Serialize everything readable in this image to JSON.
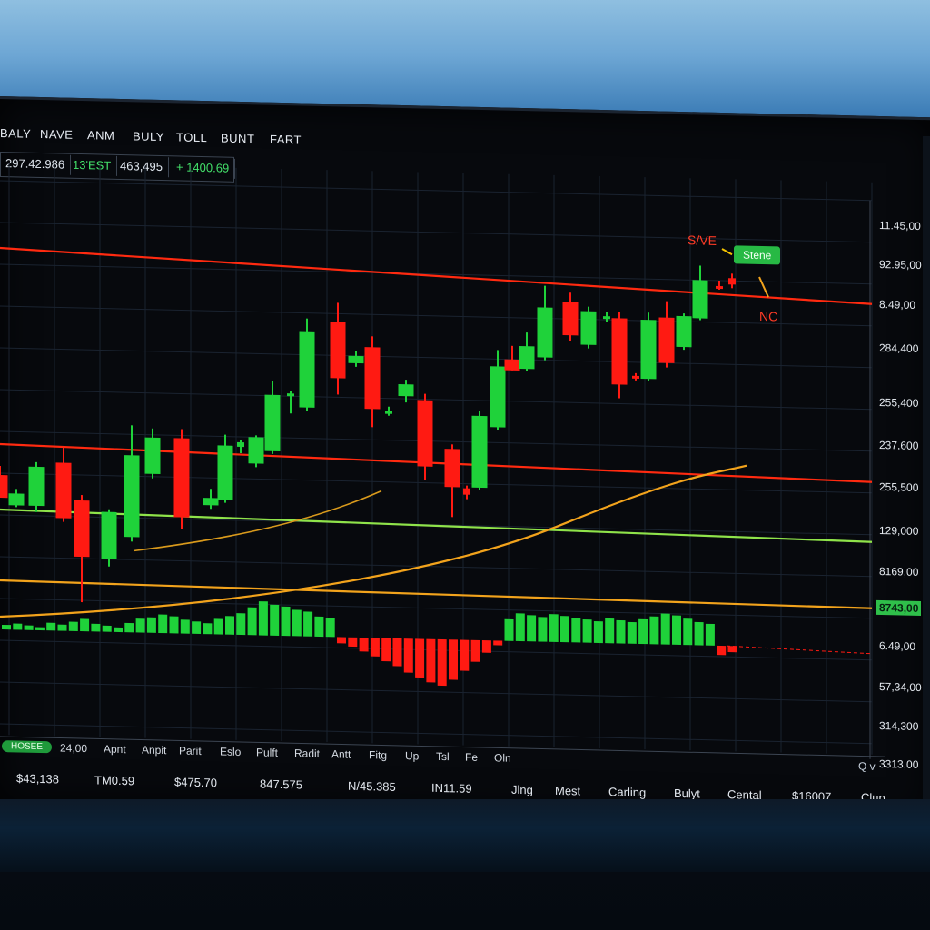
{
  "menu": [
    "BALY",
    "NAVE",
    "ANM",
    "BULY",
    "TOLL",
    "BUNT",
    "FART"
  ],
  "tickers": [
    {
      "text": "297.42.986",
      "color": "white"
    },
    {
      "text": "13'EST",
      "color": "green"
    },
    {
      "text": "463,495",
      "color": "white"
    },
    {
      "text": "+ 1400.69",
      "color": "green"
    }
  ],
  "price_axis": [
    "11.45,00",
    "92.95,00",
    "8.49,00",
    "284,400",
    "255,400",
    "237,600",
    "255,500",
    "129,000",
    "8169,00",
    "8743,00",
    "6.49,00",
    "57,34,00",
    "314,300",
    "3313,00"
  ],
  "price_axis_highlight": "8743,00",
  "annotations": {
    "save": "S/VE",
    "stone": "Stene",
    "mc": "NC"
  },
  "x_axis": {
    "pill": "HOSEE",
    "labels": [
      "24,00",
      "Apnt",
      "Anpit",
      "Parit",
      "Eslo",
      "Pulft",
      "Radit",
      "Antt",
      "Fitg",
      "Up",
      "Tsl",
      "Fe",
      "Oln"
    ],
    "search": "Q v"
  },
  "status_bar": [
    "$43,138",
    "TM0.59",
    "$475.70",
    "847.575",
    "N/45.385",
    "IN11.59",
    "Jlng",
    "Mest",
    "Carling",
    "Bulyt",
    "Cental",
    "$16007",
    "Clup"
  ],
  "colors": {
    "up": "#1fd23a",
    "down": "#ff1a12",
    "redline": "#ff2a10",
    "greenline": "#8fe34a",
    "orangeline": "#f2a31c"
  },
  "chart_data": {
    "type": "candlestick",
    "candles": [
      {
        "o": 520,
        "h": 510,
        "l": 545,
        "c": 545
      },
      {
        "o": 553,
        "h": 535,
        "l": 555,
        "c": 540
      },
      {
        "o": 553,
        "h": 505,
        "l": 560,
        "c": 510
      },
      {
        "o": 505,
        "h": 488,
        "l": 570,
        "c": 566
      },
      {
        "o": 546,
        "h": 540,
        "l": 658,
        "c": 608
      },
      {
        "o": 610,
        "h": 555,
        "l": 618,
        "c": 558
      },
      {
        "o": 585,
        "h": 462,
        "l": 590,
        "c": 495
      },
      {
        "o": 515,
        "h": 465,
        "l": 520,
        "c": 475
      },
      {
        "o": 475,
        "h": 465,
        "l": 575,
        "c": 562
      },
      {
        "o": 548,
        "h": 530,
        "l": 552,
        "c": 540
      },
      {
        "o": 542,
        "h": 470,
        "l": 545,
        "c": 482
      },
      {
        "o": 483,
        "h": 475,
        "l": 490,
        "c": 478
      },
      {
        "o": 501,
        "h": 470,
        "l": 505,
        "c": 472
      },
      {
        "o": 487,
        "h": 410,
        "l": 490,
        "c": 425
      },
      {
        "o": 425,
        "h": 420,
        "l": 445,
        "c": 423
      },
      {
        "o": 438,
        "h": 340,
        "l": 442,
        "c": 355
      },
      {
        "o": 343,
        "h": 322,
        "l": 423,
        "c": 405
      },
      {
        "o": 388,
        "h": 375,
        "l": 392,
        "c": 380
      },
      {
        "o": 370,
        "h": 358,
        "l": 458,
        "c": 438
      },
      {
        "o": 442,
        "h": 435,
        "l": 445,
        "c": 440
      },
      {
        "o": 423,
        "h": 405,
        "l": 430,
        "c": 410
      },
      {
        "o": 427,
        "h": 420,
        "l": 515,
        "c": 500
      },
      {
        "o": 480,
        "h": 475,
        "l": 555,
        "c": 522
      },
      {
        "o": 523,
        "h": 520,
        "l": 535,
        "c": 530
      },
      {
        "o": 522,
        "h": 438,
        "l": 525,
        "c": 443
      },
      {
        "o": 455,
        "h": 370,
        "l": 458,
        "c": 388
      },
      {
        "o": 380,
        "h": 365,
        "l": 392,
        "c": 392
      },
      {
        "o": 390,
        "h": 350,
        "l": 392,
        "c": 365
      },
      {
        "o": 377,
        "h": 298,
        "l": 380,
        "c": 322
      },
      {
        "o": 315,
        "h": 305,
        "l": 358,
        "c": 352
      },
      {
        "o": 362,
        "h": 320,
        "l": 366,
        "c": 325
      },
      {
        "o": 332,
        "h": 325,
        "l": 336,
        "c": 330
      },
      {
        "o": 332,
        "h": 325,
        "l": 420,
        "c": 405
      },
      {
        "o": 395,
        "h": 392,
        "l": 400,
        "c": 398
      },
      {
        "o": 398,
        "h": 325,
        "l": 400,
        "c": 333
      },
      {
        "o": 330,
        "h": 312,
        "l": 385,
        "c": 380
      },
      {
        "o": 362,
        "h": 325,
        "l": 365,
        "c": 328
      },
      {
        "o": 330,
        "h": 272,
        "l": 332,
        "c": 288
      },
      {
        "o": 294,
        "h": 288,
        "l": 298,
        "c": 294
      },
      {
        "o": 285,
        "h": 280,
        "l": 296,
        "c": 292
      }
    ],
    "horizontal_lines": [
      {
        "name": "resistance",
        "color": "red"
      },
      {
        "name": "mid",
        "color": "red"
      },
      {
        "name": "support",
        "color": "green"
      },
      {
        "name": "base",
        "color": "orange"
      }
    ],
    "volume": [
      3,
      4,
      3,
      2,
      5,
      4,
      6,
      8,
      5,
      4,
      3,
      6,
      9,
      10,
      12,
      11,
      9,
      8,
      7,
      10,
      12,
      14,
      18,
      22,
      20,
      19,
      17,
      16,
      13,
      12,
      -4,
      -6,
      -9,
      -12,
      -15,
      -18,
      -22,
      -25,
      -28,
      -30,
      -26,
      -20,
      -14,
      -8,
      -3,
      14,
      18,
      17,
      16,
      18,
      17,
      16,
      15,
      14,
      16,
      15,
      14,
      16,
      18,
      20,
      19,
      17,
      15,
      14,
      -6,
      -4
    ]
  }
}
